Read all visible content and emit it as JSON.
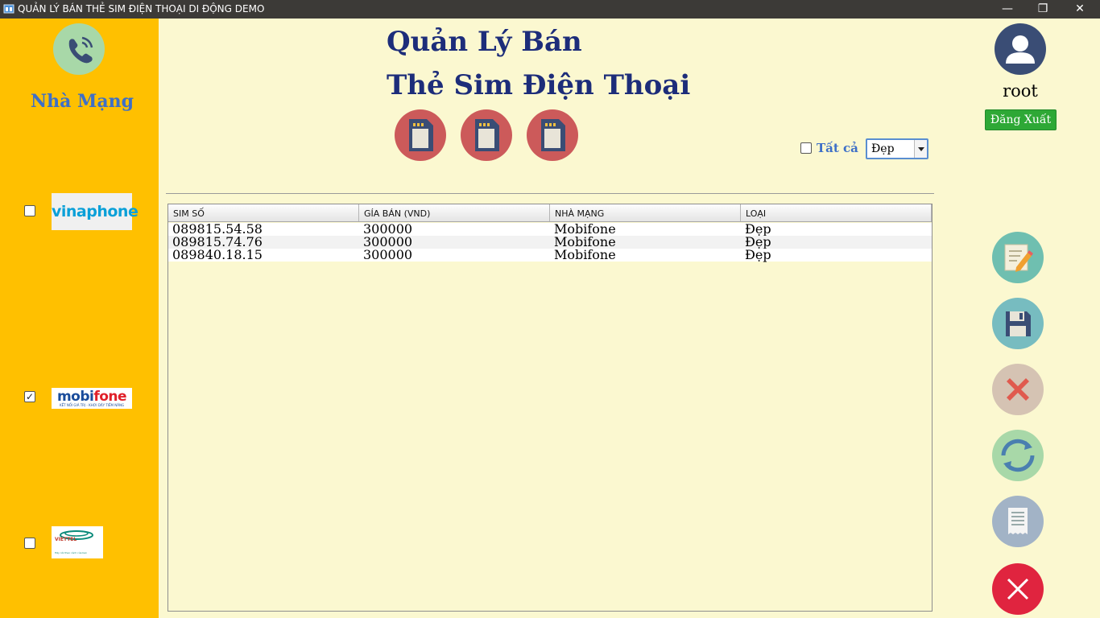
{
  "window": {
    "title": "QUẢN LÝ BÁN THẺ SIM ĐIỆN THOẠI DI ĐỘNG DEMO",
    "minimize_glyph": "—",
    "maximize_glyph": "❐",
    "close_glyph": "✕"
  },
  "sidebar": {
    "title": "Nhà Mạng",
    "carriers": [
      {
        "name": "vinaphone",
        "checked": false
      },
      {
        "name": "mobifone",
        "checked": true,
        "tagline": "KẾT NỐI GIÁ TRỊ - KHƠI DẬY TIỀM NĂNG"
      },
      {
        "name": "VIETTEL",
        "checked": false,
        "tagline": "Hãy nói theo cách của bạn"
      }
    ]
  },
  "header": {
    "title_line1": "Quản Lý Bán",
    "title_line2": "Thẻ Sim Điện Thoại"
  },
  "filter": {
    "all_label": "Tất cả",
    "all_checked": false,
    "select_value": "Đẹp"
  },
  "table": {
    "columns": [
      "SIM SỐ",
      "GÍA BÁN (VND)",
      "NHÀ MẠNG",
      "LOẠI"
    ],
    "rows": [
      [
        "089815.54.58",
        "300000",
        "Mobifone",
        "Đẹp"
      ],
      [
        "089815.74.76",
        "300000",
        "Mobifone",
        "Đẹp"
      ],
      [
        "089840.18.15",
        "300000",
        "Mobifone",
        "Đẹp"
      ]
    ]
  },
  "user": {
    "name": "root",
    "logout_label": "Đăng Xuất"
  },
  "icons": {
    "sim": "sim-card-icon",
    "edit": "edit-icon",
    "save": "save-icon",
    "delete": "delete-icon",
    "refresh": "refresh-icon",
    "receipt": "receipt-icon",
    "exit": "exit-icon"
  },
  "colors": {
    "sidebar": "#ffc000",
    "background": "#fbf8d0",
    "title": "#1d2d7a",
    "sim_button": "#cc5a5a",
    "logout": "#2ea836",
    "exit": "#e0243f"
  }
}
